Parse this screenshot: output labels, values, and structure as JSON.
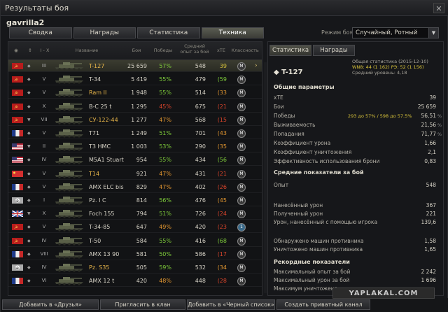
{
  "window": {
    "title": "Результаты боя"
  },
  "player": "gavrilla2",
  "top_tabs": [
    "Сводка",
    "Награды",
    "Статистика",
    "Техника"
  ],
  "battle_type": {
    "label": "Режим боя:",
    "value": "Случайный, Ротный"
  },
  "columns": {
    "sort_type": "↕",
    "sort_tier": "I - X",
    "name": "Название",
    "battles": "Бои",
    "wins": "Победы",
    "avg_exp": "Средний опыт за бой",
    "xte": "xTE",
    "mastery": "Классность"
  },
  "rows": [
    {
      "flag": "ussr",
      "type": "◆",
      "tier": "III",
      "name": "T-127",
      "prem": true,
      "battles": "25 659",
      "winrate": "57%",
      "wr_color": "green",
      "exp": "548",
      "xte": "39",
      "xte_color": "yellow",
      "mastery": "M",
      "sel": true
    },
    {
      "flag": "ussr",
      "type": "◆",
      "tier": "V",
      "name": "T-34",
      "prem": false,
      "battles": "5 419",
      "winrate": "55%",
      "wr_color": "green",
      "exp": "479",
      "xte": "(59",
      "xte_color": "green",
      "mastery": "M"
    },
    {
      "flag": "ussr",
      "type": "◆",
      "tier": "V",
      "name": "Ram II",
      "prem": true,
      "battles": "1 948",
      "winrate": "55%",
      "wr_color": "green",
      "exp": "514",
      "xte": "(33",
      "xte_color": "orange",
      "mastery": "M"
    },
    {
      "flag": "ussr",
      "type": "◆",
      "tier": "X",
      "name": "В-С 25 t",
      "prem": false,
      "battles": "1 295",
      "winrate": "45%",
      "wr_color": "red",
      "exp": "675",
      "xte": "(21",
      "xte_color": "red",
      "mastery": "M"
    },
    {
      "flag": "ussr",
      "type": "▼",
      "tier": "VII",
      "name": "СУ-122-44",
      "prem": true,
      "battles": "1 277",
      "winrate": "47%",
      "wr_color": "orange",
      "exp": "568",
      "xte": "(15",
      "xte_color": "red",
      "mastery": "M"
    },
    {
      "flag": "france",
      "type": "◆",
      "tier": "V",
      "name": "T71",
      "prem": false,
      "battles": "1 249",
      "winrate": "51%",
      "wr_color": "green",
      "exp": "701",
      "xte": "(43",
      "xte_color": "orange",
      "mastery": "M"
    },
    {
      "flag": "usa",
      "type": "▼",
      "tier": "II",
      "name": "T3 HMC",
      "prem": false,
      "battles": "1 003",
      "winrate": "53%",
      "wr_color": "green",
      "exp": "290",
      "xte": "(35",
      "xte_color": "orange",
      "mastery": "M"
    },
    {
      "flag": "usa",
      "type": "◆",
      "tier": "IV",
      "name": "M5A1 Stuart",
      "prem": false,
      "battles": "954",
      "winrate": "55%",
      "wr_color": "green",
      "exp": "434",
      "xte": "(56",
      "xte_color": "green",
      "mastery": "M"
    },
    {
      "flag": "china",
      "type": "◆",
      "tier": "V",
      "name": "T14",
      "prem": true,
      "battles": "921",
      "winrate": "47%",
      "wr_color": "orange",
      "exp": "431",
      "xte": "(21",
      "xte_color": "red",
      "mastery": "M"
    },
    {
      "flag": "france",
      "type": "◆",
      "tier": "V",
      "name": "AMX ELC bis",
      "prem": false,
      "battles": "829",
      "winrate": "47%",
      "wr_color": "orange",
      "exp": "402",
      "xte": "(26",
      "xte_color": "red",
      "mastery": "M"
    },
    {
      "flag": "germany",
      "type": "◆",
      "tier": "I",
      "name": "Pz. I C",
      "prem": false,
      "battles": "814",
      "winrate": "56%",
      "wr_color": "green",
      "exp": "476",
      "xte": "(45",
      "xte_color": "orange",
      "mastery": "M"
    },
    {
      "flag": "uk",
      "type": "▼",
      "tier": "X",
      "name": "Foch 155",
      "prem": false,
      "battles": "794",
      "winrate": "51%",
      "wr_color": "green",
      "exp": "726",
      "xte": "(24",
      "xte_color": "red",
      "mastery": "M"
    },
    {
      "flag": "ussr",
      "type": "◆",
      "tier": "V",
      "name": "T-34-85",
      "prem": false,
      "battles": "647",
      "winrate": "49%",
      "wr_color": "orange",
      "exp": "420",
      "xte": "(23",
      "xte_color": "red",
      "mastery": "1",
      "m1": true
    },
    {
      "flag": "ussr",
      "type": "◆",
      "tier": "IV",
      "name": "T-50",
      "prem": false,
      "battles": "584",
      "winrate": "55%",
      "wr_color": "green",
      "exp": "416",
      "xte": "(68",
      "xte_color": "green",
      "mastery": "M"
    },
    {
      "flag": "france",
      "type": "◆",
      "tier": "VIII",
      "name": "AMX 13 90",
      "prem": false,
      "battles": "581",
      "winrate": "50%",
      "wr_color": "green",
      "exp": "586",
      "xte": "(17",
      "xte_color": "red",
      "mastery": "M"
    },
    {
      "flag": "germany",
      "type": "◆",
      "tier": "IV",
      "name": "Pz. S35",
      "prem": true,
      "battles": "505",
      "winrate": "59%",
      "wr_color": "green",
      "exp": "532",
      "xte": "(34",
      "xte_color": "orange",
      "mastery": "M"
    },
    {
      "flag": "france",
      "type": "◆",
      "tier": "VI",
      "name": "AMX 12 t",
      "prem": false,
      "battles": "420",
      "winrate": "48%",
      "wr_color": "orange",
      "exp": "448",
      "xte": "(28",
      "xte_color": "red",
      "mastery": "M"
    }
  ],
  "panel": {
    "tabs": [
      "Статистика",
      "Награды"
    ],
    "vehicle": "T-127",
    "overall": "Общая статистика (2015-12-10)",
    "wn8": "WN8: 44 (1 162) РЭ: 52 (1 156)",
    "avg_level": "Средний уровень: 4,18",
    "sections": {
      "general": "Общие параметры",
      "avg": "Средние показатели за бой",
      "records": "Рекордные показатели"
    },
    "general": [
      {
        "k": "xTE",
        "v": "39",
        "yellow": true
      },
      {
        "k": "Бои",
        "v": "25 659"
      },
      {
        "k": "Победы",
        "mid": "293 до 57% / 598 до 57.5%",
        "v": "56,51",
        "u": "%"
      },
      {
        "k": "Выживаемость",
        "v": "21,56",
        "u": "%"
      },
      {
        "k": "Попадания",
        "v": "71,77",
        "u": "%"
      },
      {
        "k": "Коэффициент урона",
        "v": "1,66"
      },
      {
        "k": "Коэффициент уничтожения",
        "v": "2,1"
      },
      {
        "k": "Эффективность использования брони",
        "v": "0,83"
      }
    ],
    "avg": [
      {
        "k": "Опыт",
        "v": "548"
      },
      {
        "k": "Нанесённый урон",
        "v": "367"
      },
      {
        "k": "Полученный урон",
        "v": "221"
      },
      {
        "k": "Урон, нанесённый с помощью игрока",
        "v": "139,6"
      },
      {
        "k": "Обнаружено машин противника",
        "v": "1,58"
      },
      {
        "k": "Уничтожено машин противника",
        "v": "1,65"
      }
    ],
    "records": [
      {
        "k": "Максимальный опыт за бой",
        "v": "2 242"
      },
      {
        "k": "Максимальный урон за бой",
        "v": "1 696"
      },
      {
        "k": "Максимум уничтожено",
        "v": ""
      }
    ]
  },
  "bottom": {
    "add_friends": "Добавить в «Друзья»",
    "invite_clan": "Пригласить в клан",
    "blacklist": "Добавить в «Черный список»",
    "private_channel": "Создать приватный канал"
  },
  "watermark": "YAPLAKAL.COM"
}
